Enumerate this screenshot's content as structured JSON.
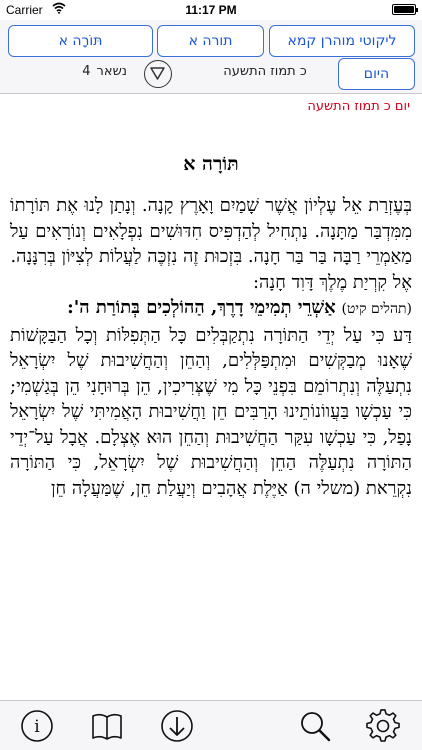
{
  "status_bar": {
    "carrier": "Carrier",
    "time": "11:17 PM",
    "wifi_icon": "wifi-icon",
    "battery_icon": "battery-icon"
  },
  "nav": {
    "collection_button": "ליקוטי מוהרן קמא",
    "torah_button": "תורה א",
    "torah_alef_button": "תּוֹרָה א",
    "today_button": "היום",
    "date_label": "כ תמוז התשעה",
    "dropdown_icon": "triangle-down-icon",
    "remaining_prefix": "נשאר",
    "remaining_count": "4"
  },
  "day_label": "יום כ תמוז התשעה",
  "document": {
    "title": "תּוֹרָה א",
    "paragraph_1": "בְּעֶזְרַת אֵל עֶלְיוֹן אֲשֶׁר שָׁמַיִם וָאָרֶץ קָנָה. וְנָתַן לָנוּ אֶת תּוֹרָתוֹ מִמִּדְבַּר מַתָּנָה. נַתְחִיל לְהַדְפִּיס חִדּוּשִׁים נִפְלָאִים וְנוֹרָאִים עַל מַאַמְרֵי רַבָּה בַּר בַּר חָנָה. בִּזְכוּת זֶה נִזְכֶּה לַעֲלוֹת לְצִיּוֹן בְּרִנָּנָה.",
    "paragraph_2": "אֶל קִרְיַת מֶלֶךְ דָּוִד חָנָה:",
    "citation": "(תהלים קיט)",
    "verse": "אַשְׁרֵי תְמִימֵי דָרֶךְ, הַהוֹלְכִים בְּתוֹרַת ה':",
    "paragraph_3": "דַּע כִּי עַל יְדֵי הַתּוֹרָה נִתְקַבְּלִים כָּל הַתְּפִלּוֹת וְכָל הַבַּקָּשׁוֹת שֶׁאָנוּ מְבַקְּשִׁים וּמִתְפַּלְּלִים, וְהַחֵן וְהַחֲשִׁיבוּת שֶׁל יִשְׂרָאֵל נִתְעַלֶּה וְנִתְרוֹמֵם בִּפְנֵי כָּל מִי שֶׁצְּרִיכִין, הֵן בְּרוּחָנִי הֵן בְּגַשְׁמִי; כִּי עַכְשָׁו בַּעֲווֹנוֹתֵינוּ הָרַבִּים חֵן וַחֲשִׁיבוּת הָאֲמִיתִּי שֶׁל יִשְׂרָאֵל נָפַל, כִּי עַכְשָׁו עִקַּר הַחֲשִׁיבוּת וְהַחֵן הוּא אֶצְלָם. אֲבָל עַל־יְדֵי הַתּוֹרָה נִתְעַלֶּה הַחֵן וְהַחֲשִׁיבוּת שֶׁל יִשְׂרָאֵל, כִּי הַתּוֹרָה נִקְרֵאת (משלי ה) אַיֶּלֶת אֲהָבִים וְיַעֲלַת חֵן, שֶׁמַּעֲלָה חֵן"
  },
  "toolbar": {
    "info_icon": "info-icon",
    "book_icon": "book-icon",
    "download_icon": "download-icon",
    "search_icon": "search-icon",
    "settings_icon": "gear-icon"
  }
}
